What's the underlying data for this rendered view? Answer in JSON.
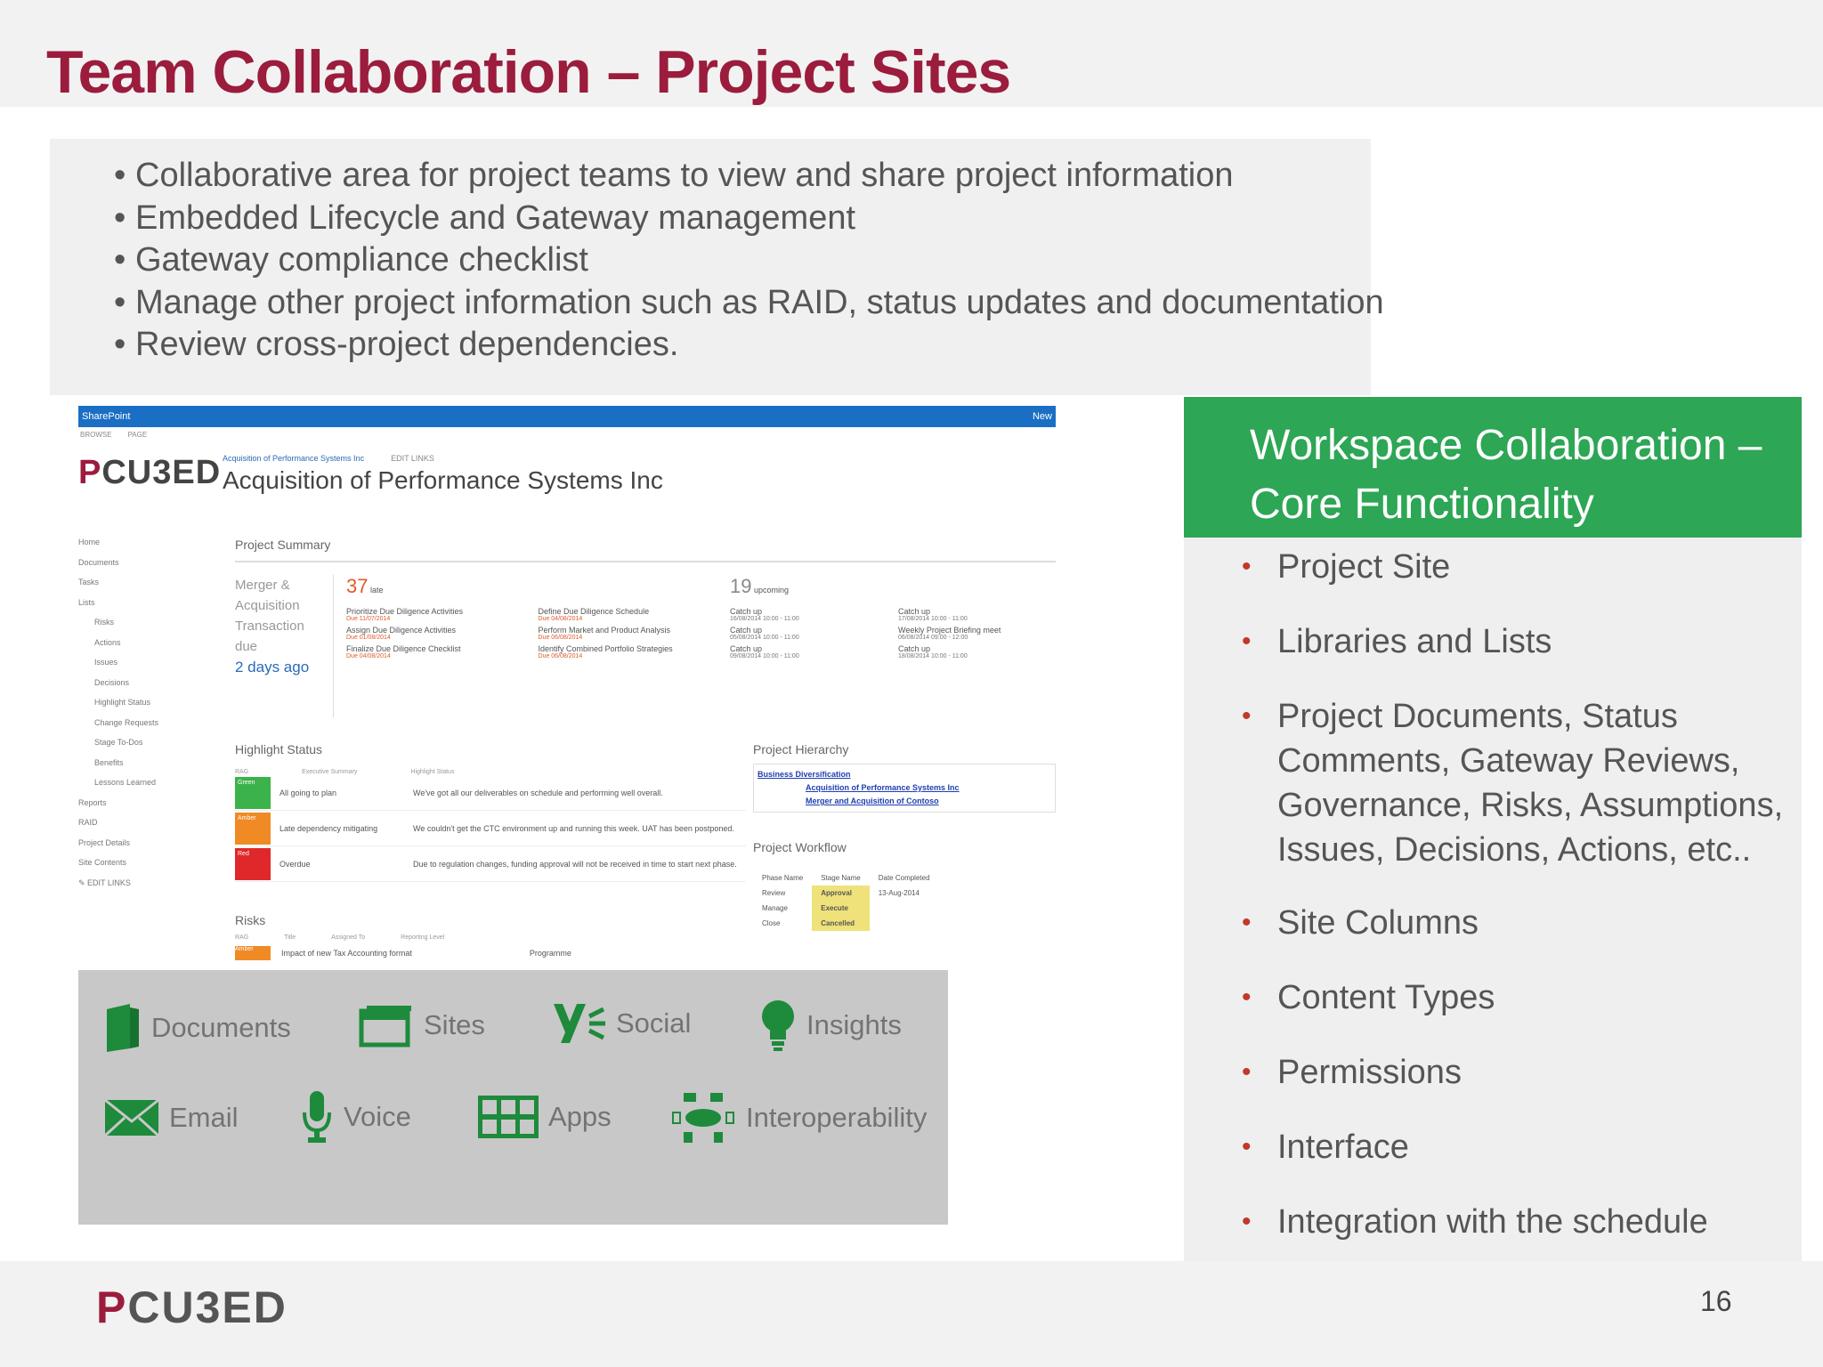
{
  "slide": {
    "title": "Team Collaboration – Project Sites",
    "bullets": [
      "Collaborative area for project teams to view and share  project information",
      "Embedded Lifecycle and Gateway management",
      "Gateway compliance checklist",
      "Manage other project information such as RAID, status updates and documentation",
      "Review cross-project dependencies."
    ],
    "page_number": "16",
    "footer_logo": {
      "p": "P",
      "rest": "CU3ED"
    }
  },
  "sharepoint": {
    "bar_left": "SharePoint",
    "bar_right": "New",
    "subnav": [
      "BROWSE",
      "PAGE"
    ],
    "logo": {
      "p": "P",
      "rest": "CU3ED"
    },
    "breadcrumb": "Acquisition of Performance Systems Inc",
    "edit_links": "EDIT LINKS",
    "site_title": "Acquisition of Performance Systems Inc",
    "left_nav": [
      {
        "label": "Home",
        "indent": false
      },
      {
        "label": "Documents",
        "indent": false
      },
      {
        "label": "Tasks",
        "indent": false
      },
      {
        "label": "Lists",
        "indent": false
      },
      {
        "label": "Risks",
        "indent": true
      },
      {
        "label": "Actions",
        "indent": true
      },
      {
        "label": "Issues",
        "indent": true
      },
      {
        "label": "Decisions",
        "indent": true
      },
      {
        "label": "Highlight Status",
        "indent": true
      },
      {
        "label": "Change Requests",
        "indent": true
      },
      {
        "label": "Stage To-Dos",
        "indent": true
      },
      {
        "label": "Benefits",
        "indent": true
      },
      {
        "label": "Lessons Learned",
        "indent": true
      },
      {
        "label": "Reports",
        "indent": false
      },
      {
        "label": "RAID",
        "indent": false
      },
      {
        "label": "Project Details",
        "indent": false
      },
      {
        "label": "Site Contents",
        "indent": false
      },
      {
        "label": "✎ EDIT LINKS",
        "indent": false
      }
    ],
    "project_summary": {
      "heading": "Project Summary",
      "merger_lines": [
        "Merger &",
        "Acquisition",
        "Transaction",
        "due"
      ],
      "ago": "2 days ago",
      "late_count": "37",
      "late_label": "late",
      "late_items": [
        {
          "name": "Prioritize Due Diligence Activities",
          "due": "Due 11/07/2014"
        },
        {
          "name": "Define Due Diligence Schedule",
          "due": "Due 04/08/2014"
        },
        {
          "name": "Assign Due Diligence Activities",
          "due": "Due 01/08/2014"
        },
        {
          "name": "Perform Market and Product Analysis",
          "due": "Due 06/08/2014"
        },
        {
          "name": "Finalize Due Diligence Checklist",
          "due": "Due 04/08/2014"
        },
        {
          "name": "Identify Combined Portfolio Strategies",
          "due": "Due 06/08/2014"
        }
      ],
      "upcoming_count": "19",
      "upcoming_label": "upcoming",
      "upcoming_items": [
        {
          "name": "Catch up",
          "due": "16/08/2014 10:00 - 11:00"
        },
        {
          "name": "Catch up",
          "due": "17/08/2014 10:00 - 11:00"
        },
        {
          "name": "Catch up",
          "due": "05/08/2014 10:00 - 11:00"
        },
        {
          "name": "Weekly Project Briefing meet",
          "due": "06/08/2014 09:00 - 12:00"
        },
        {
          "name": "Catch up",
          "due": "09/08/2014 10:00 - 11:00"
        },
        {
          "name": "Catch up",
          "due": "18/08/2014 10:00 - 11:00"
        }
      ]
    },
    "highlight_status": {
      "heading": "Highlight Status",
      "columns": [
        "RAG",
        "Executive Summary",
        "Highlight Status"
      ],
      "rows": [
        {
          "rag": "Green",
          "color": "#3cb34a",
          "summary": "All going to plan",
          "status": "We've got all our deliverables on schedule and performing well overall."
        },
        {
          "rag": "Amber",
          "color": "#f08a24",
          "summary": "Late dependency mitigating",
          "status": "We couldn't get the CTC environment up and running this week. UAT has been postponed."
        },
        {
          "rag": "Red",
          "color": "#e0282a",
          "summary": "Overdue",
          "status": "Due to regulation changes, funding approval will not be received in time to start next phase."
        }
      ]
    },
    "project_hierarchy": {
      "heading": "Project Hierarchy",
      "links": [
        "Business Diversification",
        "Acquisition of Performance Systems Inc",
        "Merger and Acquisition of Contoso"
      ]
    },
    "project_workflow": {
      "heading": "Project Workflow",
      "columns": [
        "Phase Name",
        "Stage Name",
        "Date Completed"
      ],
      "rows": [
        {
          "phase": "Review",
          "stage": "Approval",
          "date": "13-Aug-2014"
        },
        {
          "phase": "Manage",
          "stage": "Execute",
          "date": ""
        },
        {
          "phase": "Close",
          "stage": "Cancelled",
          "date": ""
        }
      ]
    },
    "risks": {
      "heading": "Risks",
      "columns": [
        "RAG",
        "Title",
        "Assigned To",
        "Reporting Level"
      ],
      "row": {
        "rag": "Amber",
        "title": "Impact of new Tax Accounting format",
        "level": "Programme"
      }
    }
  },
  "o365": {
    "services": [
      {
        "name": "Documents",
        "icon": "documents-icon"
      },
      {
        "name": "Sites",
        "icon": "sites-icon"
      },
      {
        "name": "Social",
        "icon": "yammer-icon"
      },
      {
        "name": "Insights",
        "icon": "lightbulb-icon"
      },
      {
        "name": "Email",
        "icon": "envelope-icon"
      },
      {
        "name": "Voice",
        "icon": "microphone-icon"
      },
      {
        "name": "Apps",
        "icon": "apps-grid-icon"
      },
      {
        "name": "Interoperability",
        "icon": "network-icon"
      }
    ],
    "accent": "#1e8a3c"
  },
  "right_panel": {
    "heading_lines": [
      "Workspace Collaboration –",
      "Core Functionality"
    ],
    "items": [
      "Project Site",
      "Libraries and Lists",
      "Project Documents, Status Comments, Gateway Reviews, Governance, Risks, Assumptions, Issues, Decisions, Actions, etc..",
      "Site Columns",
      "Content Types",
      "Permissions",
      "Interface",
      "Integration with the schedule"
    ],
    "accent": "#2da655",
    "bullet_color": "#c0392b"
  },
  "colors": {
    "title": "#9b1c3c",
    "sharepoint_bar": "#1a6fc4"
  }
}
